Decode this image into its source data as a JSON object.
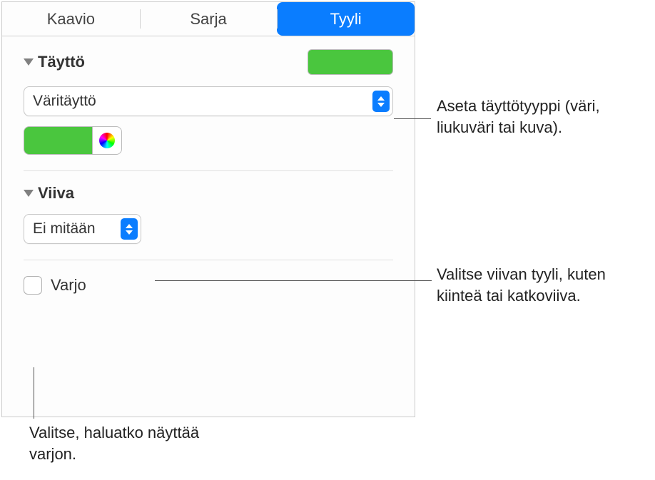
{
  "tabs": {
    "chart": "Kaavio",
    "series": "Sarja",
    "style": "Tyyli"
  },
  "fill": {
    "title": "Täyttö",
    "type_value": "Väritäyttö"
  },
  "stroke": {
    "title": "Viiva",
    "value": "Ei mitään"
  },
  "shadow": {
    "label": "Varjo"
  },
  "callouts": {
    "fill_type": "Aseta täyttötyyppi (väri, liukuväri tai kuva).",
    "stroke_style": "Valitse viivan tyyli, kuten kiinteä tai katkoviiva.",
    "shadow_toggle": "Valitse, haluatko näyttää varjon."
  }
}
